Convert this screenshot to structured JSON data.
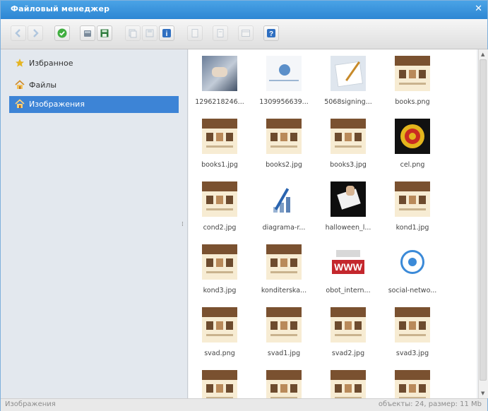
{
  "window": {
    "title": "Файловый менеджер"
  },
  "sidebar": {
    "items": [
      {
        "label": "Избранное",
        "icon": "star-icon"
      },
      {
        "label": "Файлы",
        "icon": "home-icon"
      },
      {
        "label": "Изображения",
        "icon": "images-folder-icon",
        "active": true
      }
    ]
  },
  "files": [
    {
      "name": "1296218246...",
      "thumb": "photo-handshake"
    },
    {
      "name": "1309956639...",
      "thumb": "photo-network"
    },
    {
      "name": "5068signing...",
      "thumb": "photo-signing"
    },
    {
      "name": "books.png",
      "thumb": "web"
    },
    {
      "name": "books1.jpg",
      "thumb": "web"
    },
    {
      "name": "books2.jpg",
      "thumb": "web"
    },
    {
      "name": "books3.jpg",
      "thumb": "web"
    },
    {
      "name": "cel.png",
      "thumb": "target"
    },
    {
      "name": "cond2.jpg",
      "thumb": "web"
    },
    {
      "name": "diagrama-r...",
      "thumb": "diagram"
    },
    {
      "name": "halloween_l...",
      "thumb": "hand"
    },
    {
      "name": "kond1.jpg",
      "thumb": "web"
    },
    {
      "name": "kond3.jpg",
      "thumb": "web"
    },
    {
      "name": "konditerska...",
      "thumb": "web"
    },
    {
      "name": "obot_intern...",
      "thumb": "www"
    },
    {
      "name": "social-netwo...",
      "thumb": "social"
    },
    {
      "name": "svad.png",
      "thumb": "web"
    },
    {
      "name": "svad1.jpg",
      "thumb": "web"
    },
    {
      "name": "svad2.jpg",
      "thumb": "web"
    },
    {
      "name": "svad3.jpg",
      "thumb": "web"
    },
    {
      "name": "",
      "thumb": "web"
    },
    {
      "name": "",
      "thumb": "web"
    },
    {
      "name": "",
      "thumb": "web"
    },
    {
      "name": "",
      "thumb": "web"
    }
  ],
  "status": {
    "left": "Изображения",
    "right": "объекты: 24, размер: 11 Mb"
  },
  "colors": {
    "accent": "#3d84d6",
    "titlebar": "#3c96df"
  }
}
